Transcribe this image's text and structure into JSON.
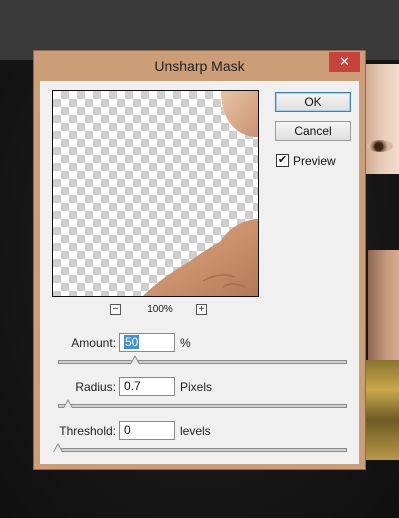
{
  "dialog": {
    "title": "Unsharp Mask",
    "close_glyph": "✕",
    "ok_label": "OK",
    "cancel_label": "Cancel",
    "preview_checked": true,
    "preview_label": "Preview",
    "zoom": {
      "minus": "−",
      "level": "100%",
      "plus": "+"
    },
    "amount": {
      "label": "Amount:",
      "value": "50",
      "unit": "%",
      "slider_fraction": 0.265
    },
    "radius": {
      "label": "Radius:",
      "value": "0.7",
      "unit": "Pixels",
      "slider_fraction": 0.035
    },
    "threshold": {
      "label": "Threshold:",
      "value": "0",
      "unit": "levels",
      "slider_fraction": 0.0
    }
  },
  "icons": {
    "close": "close-icon",
    "check": "checkmark-icon",
    "zoom_out": "zoom-out-icon",
    "zoom_in": "zoom-in-icon"
  },
  "colors": {
    "title_bar": "#cb9e78",
    "close_button": "#c7423a",
    "selection": "#3c8ee0",
    "ok_border": "#3c7fb1"
  }
}
